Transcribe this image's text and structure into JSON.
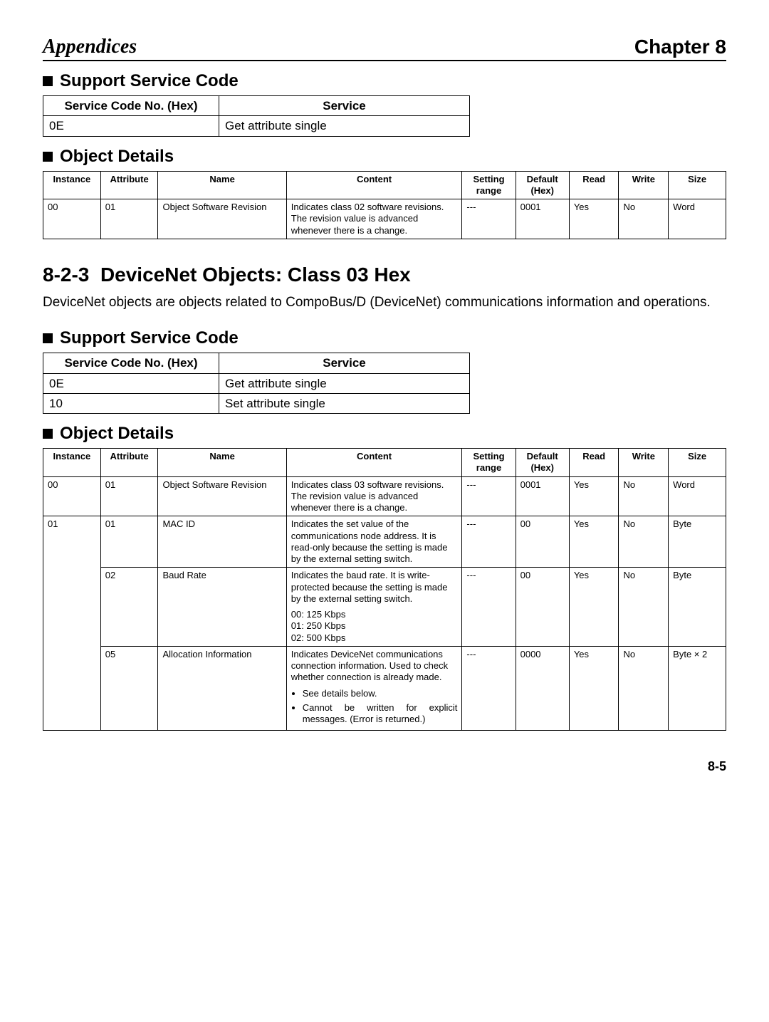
{
  "header": {
    "left": "Appendices",
    "right": "Chapter 8"
  },
  "s1": {
    "title": "Support Service Code",
    "cols": [
      "Service Code No. (Hex)",
      "Service"
    ],
    "rows": [
      {
        "code": "0E",
        "svc": "Get attribute single"
      }
    ]
  },
  "s2": {
    "title": "Object Details",
    "cols": [
      "Instance",
      "Attribute",
      "Name",
      "Content",
      "Setting range",
      "Default (Hex)",
      "Read",
      "Write",
      "Size"
    ],
    "rows": [
      {
        "instance": "00",
        "attribute": "01",
        "name": "Object Software Revision",
        "content": "Indicates class 02 software revisions. The revision value is advanced whenever there is a change.",
        "setting": "---",
        "default": "0001",
        "read": "Yes",
        "write": "No",
        "size": "Word"
      }
    ]
  },
  "sec": {
    "num": "8-2-3",
    "title": "DeviceNet Objects: Class 03 Hex",
    "body": "DeviceNet objects are objects related to CompoBus/D (DeviceNet) communications information and operations."
  },
  "s3": {
    "title": "Support Service Code",
    "cols": [
      "Service Code No. (Hex)",
      "Service"
    ],
    "rows": [
      {
        "code": "0E",
        "svc": "Get attribute single"
      },
      {
        "code": "10",
        "svc": "Set attribute single"
      }
    ]
  },
  "s4": {
    "title": "Object Details",
    "cols": [
      "Instance",
      "Attribute",
      "Name",
      "Content",
      "Setting range",
      "Default (Hex)",
      "Read",
      "Write",
      "Size"
    ],
    "rows": [
      {
        "instance": "00",
        "attribute": "01",
        "name": "Object Software Revision",
        "content_paras": [
          "Indicates class 03 software revisions. The revision value is advanced whenever there is a change."
        ],
        "content_bullets": [],
        "setting": "---",
        "default": "0001",
        "read": "Yes",
        "write": "No",
        "size": "Word"
      },
      {
        "instance": "01",
        "attribute": "01",
        "name": "MAC ID",
        "content_paras": [
          "Indicates the set value of the communications node address. It is read-only because the setting is made by the external setting switch."
        ],
        "content_bullets": [],
        "setting": "---",
        "default": "00",
        "read": "Yes",
        "write": "No",
        "size": "Byte"
      },
      {
        "instance": "",
        "attribute": "02",
        "name": "Baud Rate",
        "content_paras": [
          "Indicates the baud rate. It is write-protected because the setting is made by the external setting switch.",
          "00: 125 Kbps\n01: 250 Kbps\n02: 500 Kbps"
        ],
        "content_bullets": [],
        "setting": "---",
        "default": "00",
        "read": "Yes",
        "write": "No",
        "size": "Byte"
      },
      {
        "instance": "",
        "attribute": "05",
        "name": "Allocation Information",
        "content_paras": [
          "Indicates DeviceNet communications connection information. Used to check whether connection is already made."
        ],
        "content_bullets": [
          "See details below.",
          "Cannot be written for explicit messages. (Error is returned.)"
        ],
        "setting": "---",
        "default": "0000",
        "read": "Yes",
        "write": "No",
        "size": "Byte × 2"
      }
    ]
  },
  "page_num": "8-5",
  "chart_data": {
    "type": "table",
    "tables": [
      {
        "title": "Support Service Code (Class 02)",
        "columns": [
          "Service Code No. (Hex)",
          "Service"
        ],
        "rows": [
          [
            "0E",
            "Get attribute single"
          ]
        ]
      },
      {
        "title": "Object Details (Class 02)",
        "columns": [
          "Instance",
          "Attribute",
          "Name",
          "Content",
          "Setting range",
          "Default (Hex)",
          "Read",
          "Write",
          "Size"
        ],
        "rows": [
          [
            "00",
            "01",
            "Object Software Revision",
            "Indicates class 02 software revisions. The revision value is advanced whenever there is a change.",
            "---",
            "0001",
            "Yes",
            "No",
            "Word"
          ]
        ]
      },
      {
        "title": "Support Service Code (Class 03)",
        "columns": [
          "Service Code No. (Hex)",
          "Service"
        ],
        "rows": [
          [
            "0E",
            "Get attribute single"
          ],
          [
            "10",
            "Set attribute single"
          ]
        ]
      },
      {
        "title": "Object Details (Class 03)",
        "columns": [
          "Instance",
          "Attribute",
          "Name",
          "Content",
          "Setting range",
          "Default (Hex)",
          "Read",
          "Write",
          "Size"
        ],
        "rows": [
          [
            "00",
            "01",
            "Object Software Revision",
            "Indicates class 03 software revisions. The revision value is advanced whenever there is a change.",
            "---",
            "0001",
            "Yes",
            "No",
            "Word"
          ],
          [
            "01",
            "01",
            "MAC ID",
            "Indicates the set value of the communications node address. It is read-only because the setting is made by the external setting switch.",
            "---",
            "00",
            "Yes",
            "No",
            "Byte"
          ],
          [
            "01",
            "02",
            "Baud Rate",
            "Indicates the baud rate. It is write-protected because the setting is made by the external setting switch. 00: 125 Kbps 01: 250 Kbps 02: 500 Kbps",
            "---",
            "00",
            "Yes",
            "No",
            "Byte"
          ],
          [
            "01",
            "05",
            "Allocation Information",
            "Indicates DeviceNet communications connection information. Used to check whether connection is already made. See details below. Cannot be written for explicit messages. (Error is returned.)",
            "---",
            "0000",
            "Yes",
            "No",
            "Byte × 2"
          ]
        ]
      }
    ]
  }
}
